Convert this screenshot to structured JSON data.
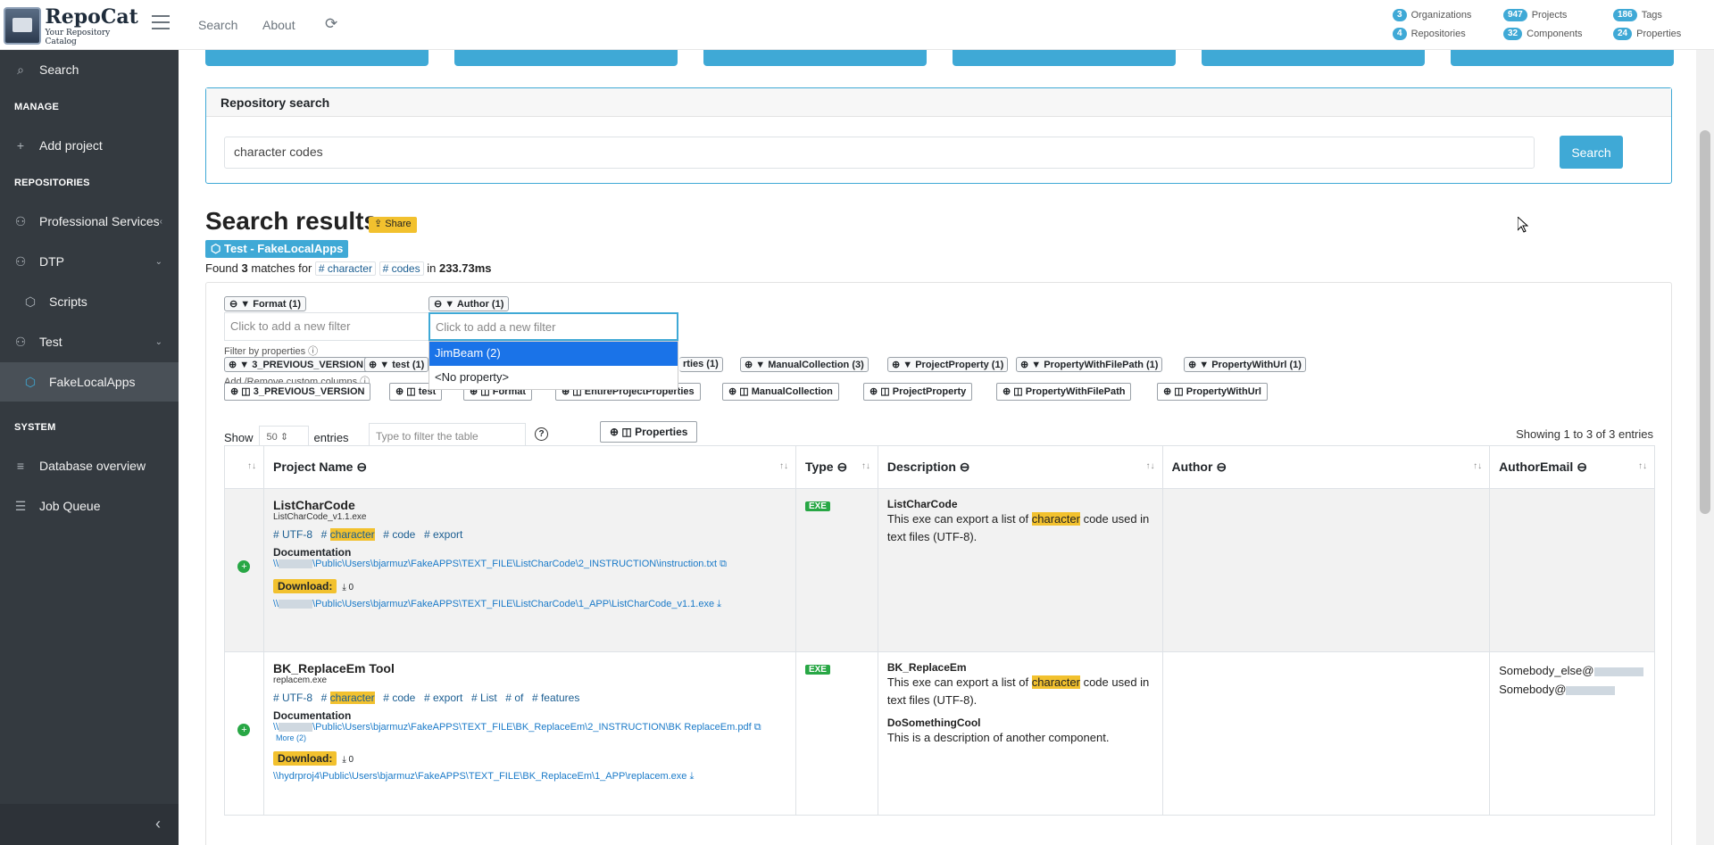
{
  "brand": {
    "name": "RepoCat",
    "tagline": "Your Repository Catalog"
  },
  "nav": {
    "search": "Search",
    "about": "About"
  },
  "stats": [
    {
      "count": "3",
      "label": "Organizations"
    },
    {
      "count": "947",
      "label": "Projects"
    },
    {
      "count": "186",
      "label": "Tags"
    },
    {
      "count": "4",
      "label": "Repositories"
    },
    {
      "count": "32",
      "label": "Components"
    },
    {
      "count": "24",
      "label": "Properties"
    }
  ],
  "sidebar": {
    "search": "Search",
    "manage_header": "MANAGE",
    "add_project": "Add project",
    "repositories_header": "REPOSITORIES",
    "professional_services": "Professional Services",
    "dtp": "DTP",
    "scripts": "Scripts",
    "test": "Test",
    "fakelocalapps": "FakeLocalApps",
    "system_header": "SYSTEM",
    "database_overview": "Database overview",
    "job_queue": "Job Queue"
  },
  "repo_search": {
    "header": "Repository search",
    "value": "character codes",
    "button": "Search"
  },
  "results": {
    "title": "Search results",
    "share": "Share",
    "repo_tag": "Test - FakeLocalApps",
    "found_prefix": "Found",
    "found_count": "3",
    "found_mid": "matches for",
    "term1": "# character",
    "term2": "# codes",
    "found_in": "in",
    "time": "233.73ms"
  },
  "filters": {
    "format_badge": "Format (1)",
    "author_badge": "Author (1)",
    "format_placeholder": "Click to add a new filter",
    "author_placeholder": "Click to add a new filter",
    "dropdown": [
      "JimBeam (2)",
      "<No property>"
    ],
    "filter_by_props": "Filter by properties",
    "props": [
      "3_PREVIOUS_VERSION (3)",
      "test (1)",
      "rties (1)",
      "ManualCollection (3)",
      "ProjectProperty (1)",
      "PropertyWithFilePath (1)",
      "PropertyWithUrl (1)"
    ],
    "custom_columns_label": "Add /Remove custom columns",
    "columns": [
      "3_PREVIOUS_VERSION",
      "test",
      "Format",
      "EntireProjectProperties",
      "ManualCollection",
      "ProjectProperty",
      "PropertyWithFilePath",
      "PropertyWithUrl"
    ]
  },
  "table_controls": {
    "show": "Show",
    "entries_value": "50",
    "entries": "entries",
    "filter_placeholder": "Type to filter the table",
    "properties_btn": "Properties",
    "showing": "Showing 1 to 3 of 3 entries"
  },
  "columns": {
    "project_name": "Project Name",
    "type": "Type",
    "description": "Description",
    "author": "Author",
    "author_email": "AuthorEmail"
  },
  "rows": [
    {
      "name": "ListCharCode",
      "file": "ListCharCode_v1.1.exe",
      "tags": [
        "UTF-8",
        "character",
        "code",
        "export"
      ],
      "doc_label": "Documentation",
      "doc_link": "Public\\Users\\bjarmuz\\FakeAPPS\\TEXT_FILE\\ListCharCode\\2_INSTRUCTION\\instruction.txt",
      "download": "Download:",
      "dl_count": "0",
      "app_link": "Public\\Users\\bjarmuz\\FakeAPPS\\TEXT_FILE\\ListCharCode\\1_APP\\ListCharCode_v1.1.exe",
      "type": "EXE",
      "desc_title": "ListCharCode",
      "desc_pre": "This exe can export a list of",
      "desc_hl": "character",
      "desc_post": "code used in text files (UTF-8)."
    },
    {
      "name": "BK_ReplaceEm Tool",
      "file": "replacem.exe",
      "tags": [
        "UTF-8",
        "character",
        "code",
        "export",
        "List",
        "of",
        "features"
      ],
      "doc_label": "Documentation",
      "doc_link": "Public\\Users\\bjarmuz\\FakeAPPS\\TEXT_FILE\\BK_ReplaceEm\\2_INSTRUCTION\\BK ReplaceEm.pdf",
      "more": "More (2)",
      "download": "Download:",
      "dl_count": "0",
      "app_link": "\\\\hydrproj4\\Public\\Users\\bjarmuz\\FakeAPPS\\TEXT_FILE\\BK_ReplaceEm\\1_APP\\replacem.exe",
      "type": "EXE",
      "desc_title": "BK_ReplaceEm",
      "desc_pre": "This exe can export a list of",
      "desc_hl": "character",
      "desc_post": "code used in text files (UTF-8).",
      "desc2_title": "DoSomethingCool",
      "desc2_text": "This is a description of another component.",
      "email1": "Somebody_else@",
      "email2": "Somebody@"
    }
  ]
}
